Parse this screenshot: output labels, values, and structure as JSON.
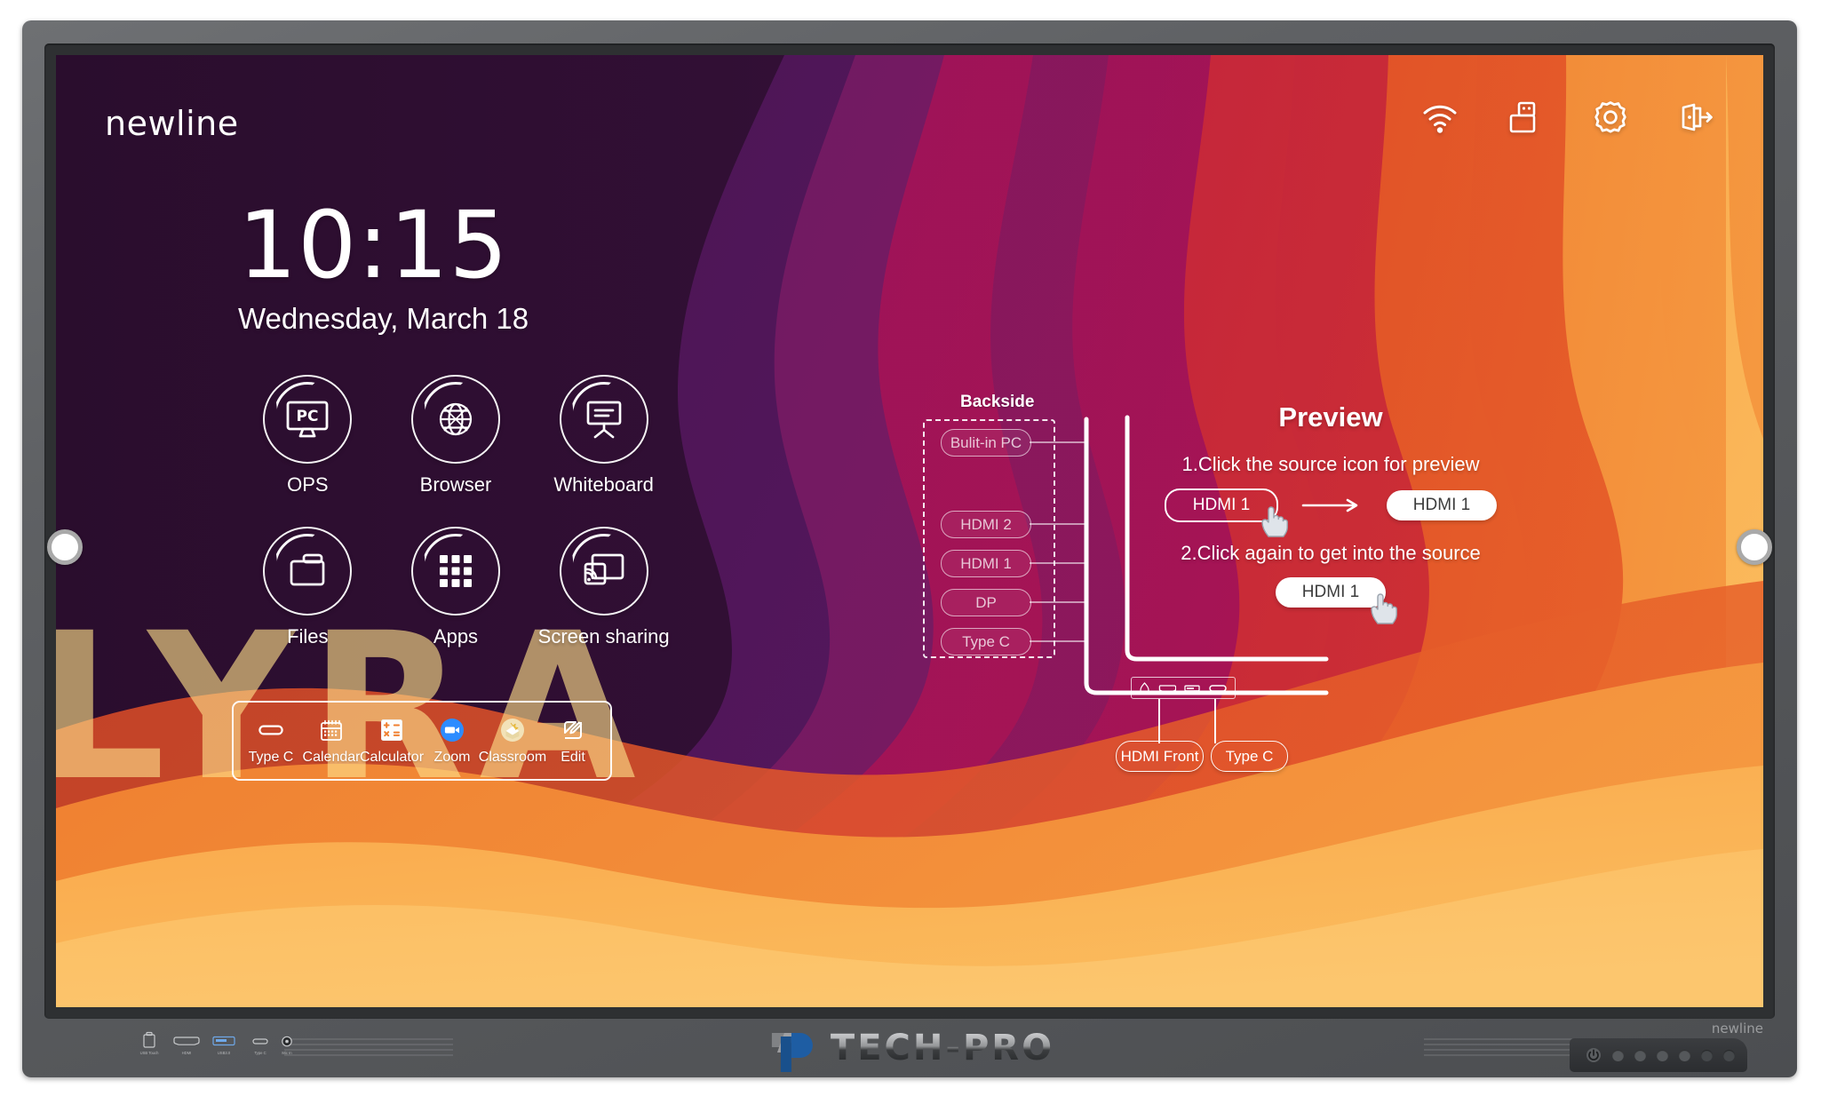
{
  "device": {
    "brand_bezel": "newline",
    "watermark_text": "TECH-PRO",
    "ports": [
      {
        "label": "USB Touch",
        "icon": "usb-b-icon"
      },
      {
        "label": "HDMI",
        "icon": "hdmi-icon"
      },
      {
        "label": "USB3.0",
        "icon": "usb-a-icon"
      },
      {
        "label": "Type C",
        "icon": "type-c-icon"
      },
      {
        "label": "Mic In",
        "icon": "mic-in-icon"
      }
    ]
  },
  "home": {
    "brand": "newline",
    "clock": {
      "time": "10:15",
      "date": "Wednesday, March 18"
    },
    "wallpaper_wordmark": "LYRA",
    "status_icons": [
      {
        "name": "wifi-icon",
        "label": "Wi-Fi"
      },
      {
        "name": "usb-drive-icon",
        "label": "USB"
      },
      {
        "name": "gear-icon",
        "label": "Settings"
      },
      {
        "name": "exit-icon",
        "label": "Exit"
      }
    ],
    "launcher": [
      {
        "label": "OPS",
        "icon": "pc-monitor-icon"
      },
      {
        "label": "Browser",
        "icon": "globe-icon"
      },
      {
        "label": "Whiteboard",
        "icon": "whiteboard-easel-icon"
      },
      {
        "label": "Files",
        "icon": "folder-icon"
      },
      {
        "label": "Apps",
        "icon": "grid-apps-icon"
      },
      {
        "label": "Screen sharing",
        "icon": "screen-cast-icon"
      }
    ],
    "dock": [
      {
        "label": "Type C",
        "icon": "type-c-icon"
      },
      {
        "label": "Calendar",
        "icon": "calendar-icon"
      },
      {
        "label": "Calculator",
        "icon": "calculator-icon"
      },
      {
        "label": "Zoom",
        "icon": "zoom-video-icon"
      },
      {
        "label": "Classroom",
        "icon": "classroom-icon"
      },
      {
        "label": "Edit",
        "icon": "edit-pencil-icon"
      }
    ]
  },
  "diagram": {
    "backside_title": "Backside",
    "backside_sources": [
      {
        "label": "Bulit-in PC"
      },
      {
        "label": "HDMI 2"
      },
      {
        "label": "HDMI 1"
      },
      {
        "label": "DP"
      },
      {
        "label": "Type C"
      }
    ],
    "front_sources": [
      {
        "label": "HDMI Front"
      },
      {
        "label": "Type C"
      }
    ]
  },
  "preview": {
    "title": "Preview",
    "step1": "1.Click the source icon for preview",
    "step2": "2.Click again to get into the source",
    "chip_outline": "HDMI 1",
    "chip_filled": "HDMI 1",
    "chip_step2": "HDMI 1"
  },
  "colors": {
    "wallpaper_dark": "#2d0e30",
    "wallpaper_purple": "#5a1a63",
    "wallpaper_magenta": "#a8135c",
    "wallpaper_red": "#d83a2a",
    "wallpaper_orange": "#f08030",
    "wallpaper_yellow": "#fbbf5c",
    "zoom_blue": "#2d8cff",
    "accent_white": "#ffffff"
  }
}
